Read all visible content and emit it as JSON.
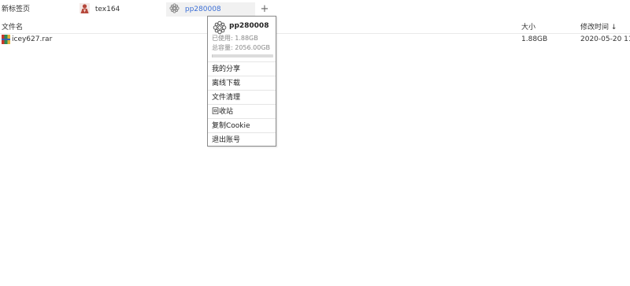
{
  "tabs": {
    "new_tab": "新标签页",
    "account1": "tex164",
    "account2": "pp280008",
    "add": "+"
  },
  "columns": {
    "name": "文件名",
    "size": "大小",
    "modified": "修改时间 ↓"
  },
  "files": [
    {
      "name": "icey627.rar",
      "size": "1.88GB",
      "modified": "2020-05-20 11:"
    }
  ],
  "account_menu": {
    "username": "pp280008",
    "used": "已使用: 1.88GB",
    "total": "总容量: 2056.00GB",
    "usage_fraction": 0.0009,
    "items": [
      "我的分享",
      "离线下载",
      "文件清理",
      "回收站",
      "复制Cookie",
      "退出账号"
    ]
  }
}
